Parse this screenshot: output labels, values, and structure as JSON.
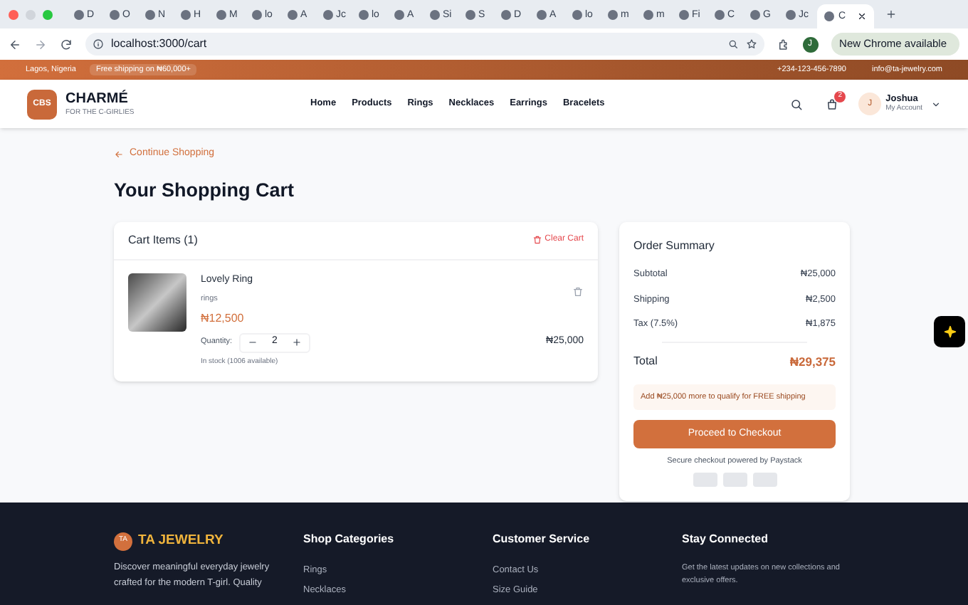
{
  "browser": {
    "tabs": [
      {
        "label": "D",
        "selected": false
      },
      {
        "label": "O",
        "selected": false
      },
      {
        "label": "N",
        "selected": false
      },
      {
        "label": "H",
        "selected": false
      },
      {
        "label": "M",
        "selected": false
      },
      {
        "label": "lo",
        "selected": false
      },
      {
        "label": "A",
        "selected": false
      },
      {
        "label": "Jc",
        "selected": false
      },
      {
        "label": "lo",
        "selected": false
      },
      {
        "label": "A",
        "selected": false
      },
      {
        "label": "Si",
        "selected": false
      },
      {
        "label": "S",
        "selected": false
      },
      {
        "label": "D",
        "selected": false
      },
      {
        "label": "A",
        "selected": false
      },
      {
        "label": "lo",
        "selected": false
      },
      {
        "label": "m",
        "selected": false
      },
      {
        "label": "m",
        "selected": false
      },
      {
        "label": "Fi",
        "selected": false
      },
      {
        "label": "C",
        "selected": false
      },
      {
        "label": "G",
        "selected": false
      },
      {
        "label": "Jc",
        "selected": false
      },
      {
        "label": "C",
        "selected": true
      }
    ],
    "url": "localhost:3000/cart",
    "profile_initial": "J",
    "update_button": "New Chrome available"
  },
  "top_bar": {
    "location": "Lagos, Nigeria",
    "shipping": "Free shipping on ₦60,000+",
    "phone": "+234-123-456-7890",
    "email": "info@ta-jewelry.com"
  },
  "header": {
    "logo_mark": "CBS",
    "brand": "CHARMÉ",
    "tagline": "FOR THE C-GIRLIES",
    "nav": [
      "Home",
      "Products",
      "Rings",
      "Necklaces",
      "Earrings",
      "Bracelets"
    ],
    "cart_count": "2",
    "user_initial": "J",
    "user_name": "Joshua",
    "user_sub": "My Account"
  },
  "back_link": "Continue Shopping",
  "title": "Your Shopping Cart",
  "cart": {
    "heading": "Cart Items (1)",
    "clear": "Clear Cart",
    "items": [
      {
        "name": "Lovely Ring",
        "category": "rings",
        "price": "₦12,500",
        "quantity_label": "Quantity:",
        "quantity": "2",
        "stock": "In stock (1006 available)",
        "line_total": "₦25,000"
      }
    ]
  },
  "summary": {
    "title": "Order Summary",
    "rows": [
      {
        "label": "Subtotal",
        "value": "₦25,000"
      },
      {
        "label": "Shipping",
        "value": "₦2,500"
      },
      {
        "label": "Tax (7.5%)",
        "value": "₦1,875"
      }
    ],
    "total_label": "Total",
    "total": "₦29,375",
    "notice": "Add ₦25,000 more to qualify for FREE shipping",
    "checkout": "Proceed to Checkout",
    "secure": "Secure checkout powered by Paystack"
  },
  "footer": {
    "logo_mark": "TA",
    "brand": "TA JEWELRY",
    "about": "Discover meaningful everyday jewelry crafted for the modern T-girl. Quality",
    "columns": [
      {
        "title": "Shop Categories",
        "links": [
          "Rings",
          "Necklaces"
        ]
      },
      {
        "title": "Customer Service",
        "links": [
          "Contact Us",
          "Size Guide"
        ]
      },
      {
        "title": "Stay Connected",
        "text": "Get the latest updates on new collections and exclusive offers."
      }
    ]
  }
}
